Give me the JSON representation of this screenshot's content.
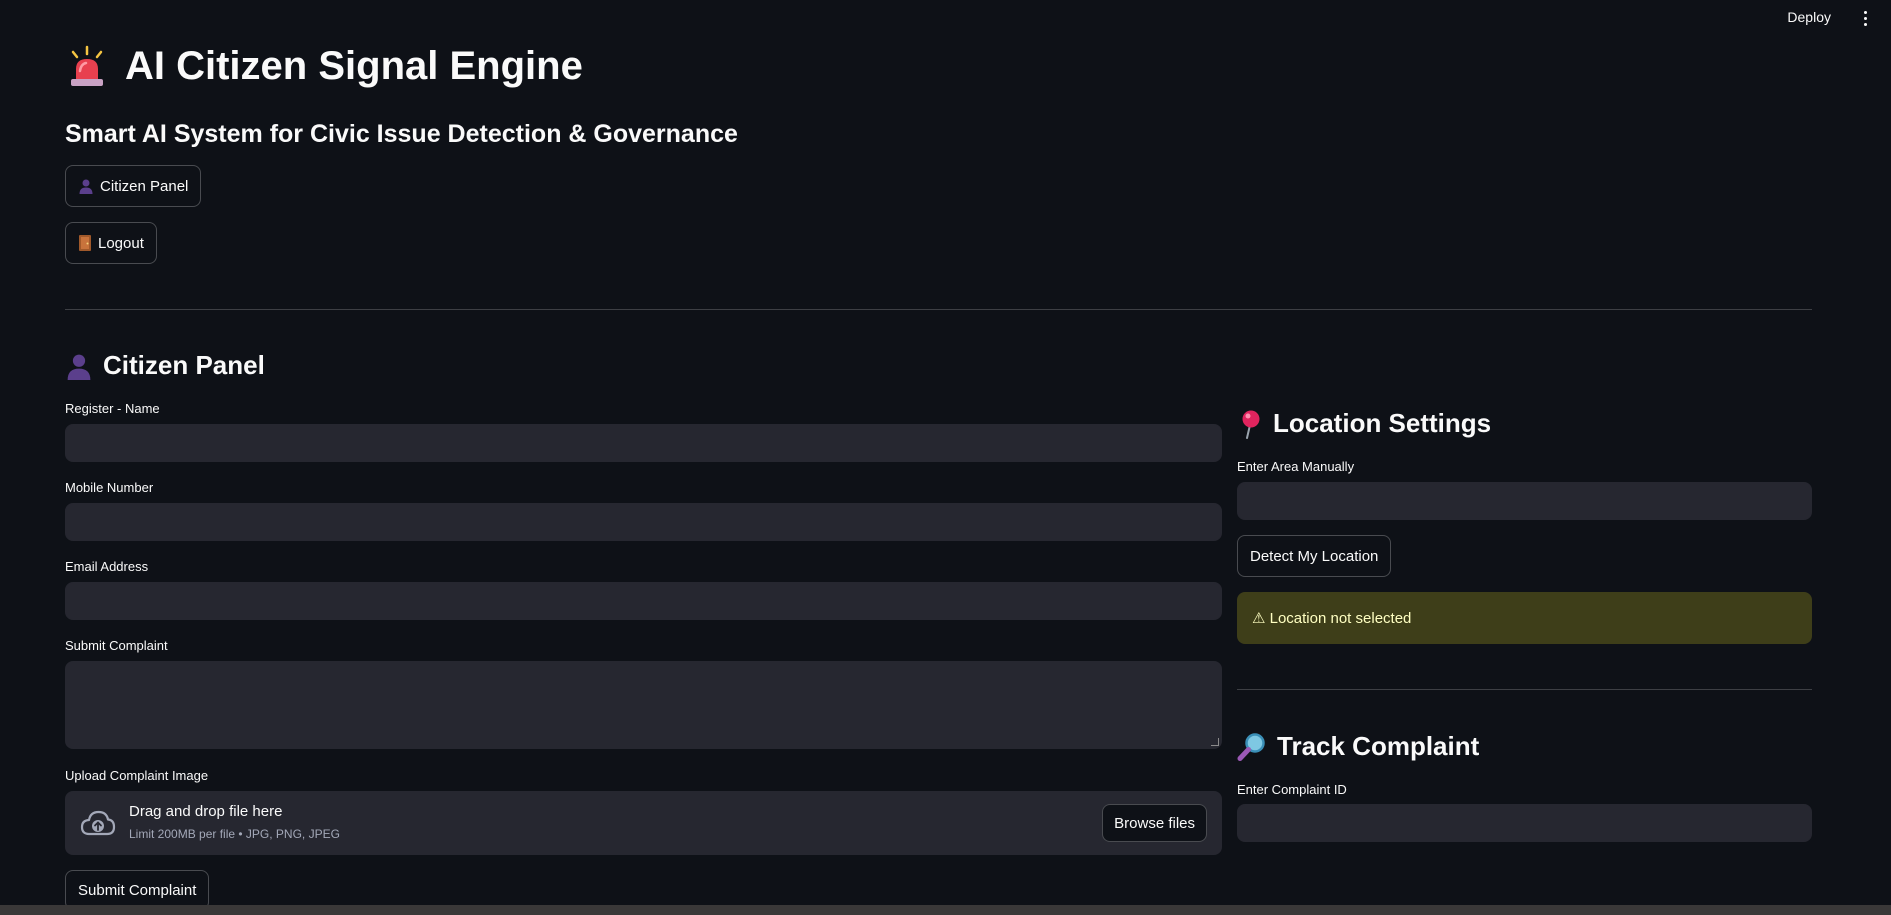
{
  "topbar": {
    "deploy_label": "Deploy",
    "menu_icon": "kebab-menu-icon"
  },
  "header": {
    "title": "AI Citizen Signal Engine",
    "title_icon": "siren-icon",
    "subtitle": "Smart AI System for Civic Issue Detection & Governance"
  },
  "nav": {
    "citizen_panel_label": "Citizen Panel",
    "citizen_panel_icon": "user-silhouette-icon",
    "logout_label": "Logout",
    "logout_icon": "door-icon"
  },
  "citizen_panel": {
    "heading": "Citizen Panel",
    "heading_icon": "user-silhouette-icon",
    "name_label": "Register - Name",
    "name_value": "",
    "mobile_label": "Mobile Number",
    "mobile_value": "",
    "email_label": "Email Address",
    "email_value": "",
    "complaint_label": "Submit Complaint",
    "complaint_value": "",
    "upload_label": "Upload Complaint Image",
    "upload_main": "Drag and drop file here",
    "upload_sub": "Limit 200MB per file • JPG, PNG, JPEG",
    "browse_label": "Browse files",
    "submit_label": "Submit Complaint"
  },
  "location": {
    "heading": "Location Settings",
    "heading_icon": "pushpin-icon",
    "area_label": "Enter Area Manually",
    "area_value": "",
    "detect_label": "Detect My Location",
    "warning_text": "⚠ Location not selected"
  },
  "track": {
    "heading": "Track Complaint",
    "heading_icon": "magnifier-icon",
    "id_label": "Enter Complaint ID",
    "id_value": ""
  },
  "colors": {
    "background": "#0e1117",
    "input_bg": "#262730",
    "warning_bg": "#3e3e19",
    "warning_text": "#ffffc2"
  }
}
